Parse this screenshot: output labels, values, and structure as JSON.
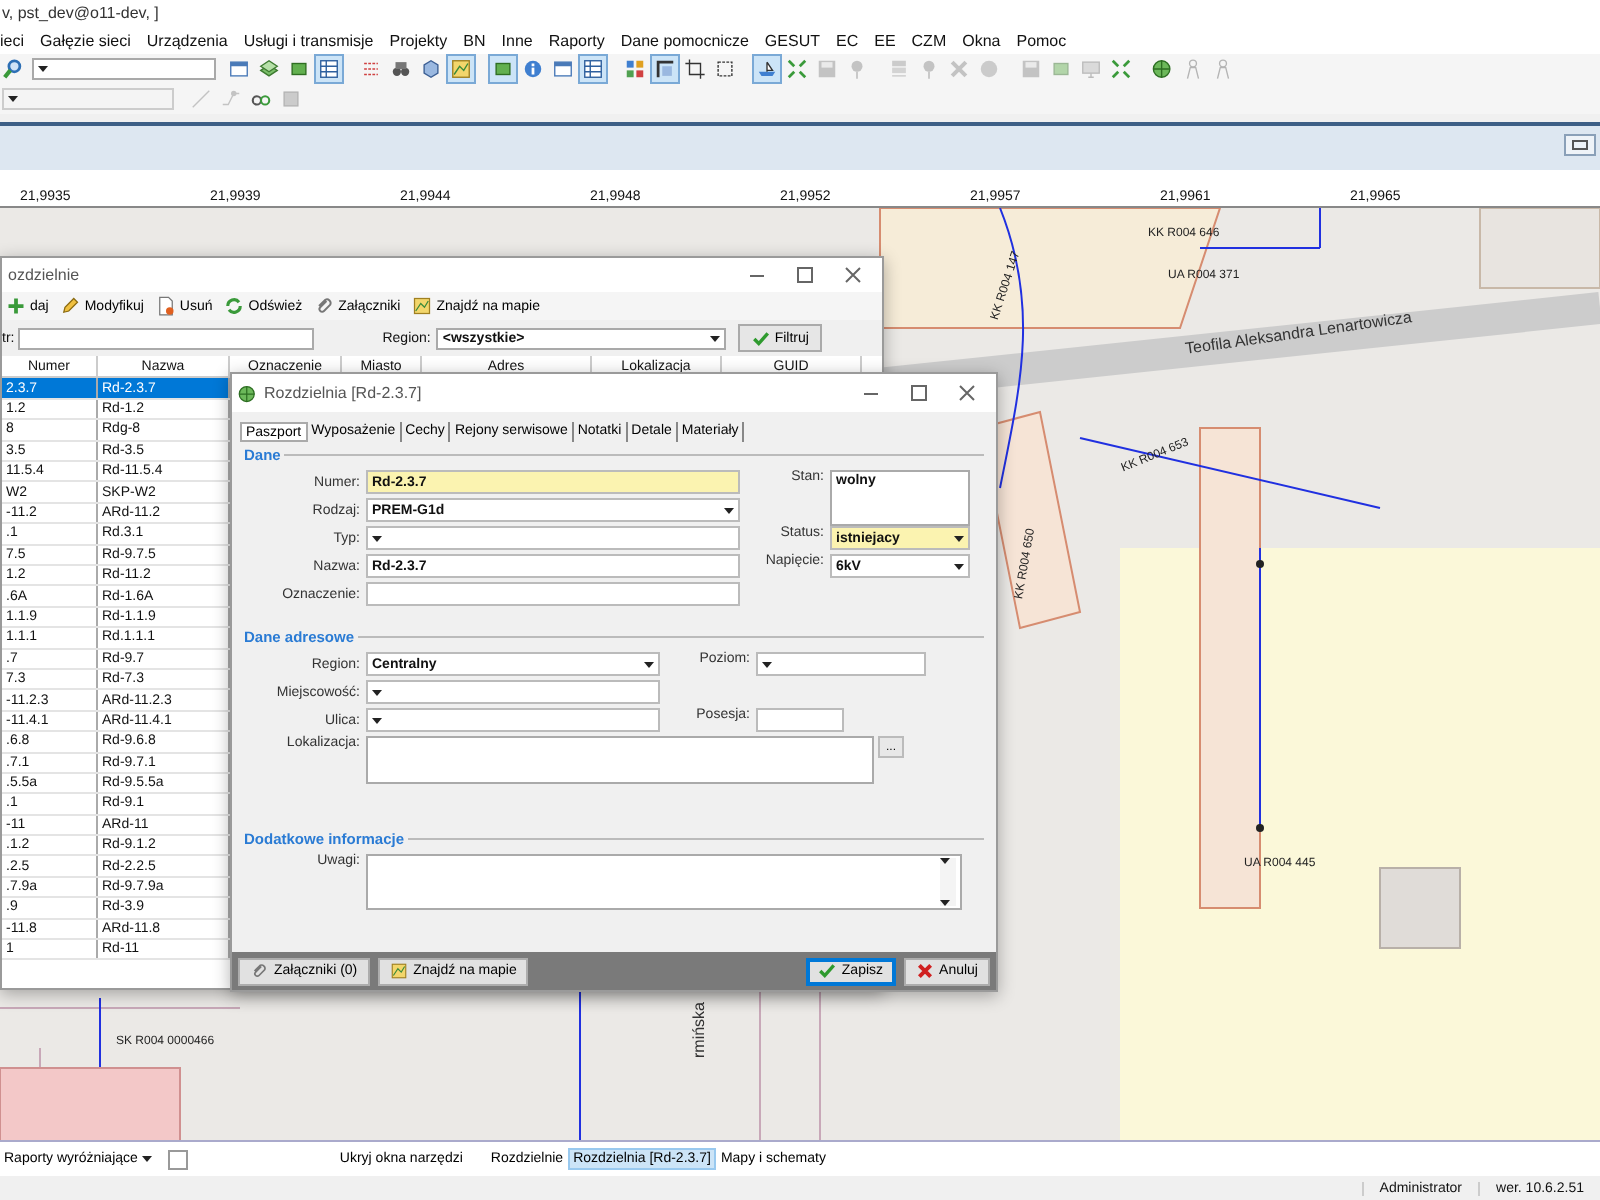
{
  "window": {
    "title": "v, pst_dev@o11-dev, ]"
  },
  "menu": [
    "ieci",
    "Gałęzie sieci",
    "Urządzenia",
    "Usługi i transmisje",
    "Projekty",
    "BN",
    "Inne",
    "Raporty",
    "Dane pomocnicze",
    "GESUT",
    "EC",
    "EE",
    "CZM",
    "Okna",
    "Pomoc"
  ],
  "toolbar_1": {
    "items": [
      {
        "kind": "window",
        "selected": false,
        "disabled": false
      },
      {
        "kind": "layers",
        "selected": false,
        "disabled": false
      },
      {
        "kind": "box",
        "selected": false,
        "disabled": false
      },
      {
        "kind": "table",
        "selected": true,
        "disabled": false
      },
      {
        "kind": "dots",
        "selected": false,
        "disabled": false
      },
      {
        "kind": "binoculars",
        "selected": false,
        "disabled": false
      },
      {
        "kind": "cube",
        "selected": false,
        "disabled": false
      },
      {
        "kind": "map",
        "selected": true,
        "disabled": false
      },
      {
        "kind": "box",
        "selected": true,
        "disabled": false
      },
      {
        "kind": "info",
        "selected": false,
        "disabled": false
      },
      {
        "kind": "window",
        "selected": false,
        "disabled": false
      },
      {
        "kind": "table",
        "selected": true,
        "disabled": false
      },
      {
        "kind": "grid",
        "selected": false,
        "disabled": false
      },
      {
        "kind": "frame",
        "selected": true,
        "disabled": false
      },
      {
        "kind": "crop",
        "selected": false,
        "disabled": false
      },
      {
        "kind": "expand",
        "selected": false,
        "disabled": false
      },
      {
        "kind": "boat",
        "selected": true,
        "disabled": false
      },
      {
        "kind": "arrows",
        "selected": false,
        "disabled": false
      },
      {
        "kind": "disk",
        "selected": false,
        "disabled": true
      },
      {
        "kind": "pin",
        "selected": false,
        "disabled": true
      },
      {
        "kind": "stack",
        "selected": false,
        "disabled": true
      },
      {
        "kind": "pin",
        "selected": false,
        "disabled": true
      },
      {
        "kind": "cross",
        "selected": false,
        "disabled": true
      },
      {
        "kind": "circle",
        "selected": false,
        "disabled": true
      },
      {
        "kind": "disk",
        "selected": false,
        "disabled": true
      },
      {
        "kind": "box",
        "selected": false,
        "disabled": true
      },
      {
        "kind": "monitor",
        "selected": false,
        "disabled": true
      },
      {
        "kind": "arrows",
        "selected": false,
        "disabled": false
      },
      {
        "kind": "globe",
        "selected": false,
        "disabled": false
      },
      {
        "kind": "person",
        "selected": false,
        "disabled": true
      },
      {
        "kind": "person",
        "selected": false,
        "disabled": true
      }
    ]
  },
  "toolbar_2": {
    "items": [
      {
        "kind": "line",
        "selected": false,
        "disabled": true
      },
      {
        "kind": "node",
        "selected": false,
        "disabled": true
      },
      {
        "kind": "link",
        "selected": false,
        "disabled": false
      },
      {
        "kind": "stop",
        "selected": false,
        "disabled": true
      }
    ]
  },
  "ruler": {
    "ticks": [
      "21,9935",
      "21,9939",
      "21,9944",
      "21,9948",
      "21,9952",
      "21,9957",
      "21,9961",
      "21,9965"
    ]
  },
  "map": {
    "labels": [
      {
        "text": "Teofila Aleksandra Lenartowicza",
        "kind": "street"
      },
      {
        "text": "KK R004 646",
        "kind": "asset"
      },
      {
        "text": "UA R004 371",
        "kind": "asset"
      },
      {
        "text": "KK R004 653",
        "kind": "asset"
      },
      {
        "text": "KK R004 147",
        "kind": "asset"
      },
      {
        "text": "KK R004 650",
        "kind": "asset"
      },
      {
        "text": "UA R004 445",
        "kind": "asset"
      },
      {
        "text": "SK R004 0000466",
        "kind": "asset"
      },
      {
        "text": "rmińska",
        "kind": "street"
      }
    ]
  },
  "list_window": {
    "title": "ozdzielnie",
    "toolbar": [
      {
        "label": "daj",
        "kind": "plus"
      },
      {
        "label": "Modyfikuj",
        "kind": "pencil"
      },
      {
        "label": "Usuń",
        "kind": "doc"
      },
      {
        "label": "Odśwież",
        "kind": "refresh"
      },
      {
        "label": "Załączniki",
        "kind": "clip"
      },
      {
        "label": "Znajdź na mapie",
        "kind": "map"
      }
    ],
    "filter": {
      "label": "tr:",
      "region_label": "Region:",
      "region_value": "<wszystkie>",
      "button": "Filtruj"
    },
    "columns": [
      "Numer",
      "Nazwa",
      "Oznaczenie",
      "Miasto",
      "Adres",
      "Lokalizacja",
      "GUID"
    ],
    "rows": [
      {
        "numer": "2.3.7",
        "nazwa": "Rd-2.3.7",
        "selected": true
      },
      {
        "numer": "1.2",
        "nazwa": "Rd-1.2",
        "selected": false
      },
      {
        "numer": "8",
        "nazwa": "Rdg-8",
        "selected": false
      },
      {
        "numer": "3.5",
        "nazwa": "Rd-3.5",
        "selected": false
      },
      {
        "numer": "11.5.4",
        "nazwa": "Rd-11.5.4",
        "selected": false
      },
      {
        "numer": "W2",
        "nazwa": "SKP-W2",
        "selected": false
      },
      {
        "numer": "-11.2",
        "nazwa": "ARd-11.2",
        "selected": false
      },
      {
        "numer": ".1",
        "nazwa": "Rd.3.1",
        "selected": false
      },
      {
        "numer": "7.5",
        "nazwa": "Rd-9.7.5",
        "selected": false
      },
      {
        "numer": "1.2",
        "nazwa": "Rd-11.2",
        "selected": false
      },
      {
        "numer": ".6A",
        "nazwa": "Rd-1.6A",
        "selected": false
      },
      {
        "numer": "1.1.9",
        "nazwa": "Rd-1.1.9",
        "selected": false
      },
      {
        "numer": "1.1.1",
        "nazwa": "Rd.1.1.1",
        "selected": false
      },
      {
        "numer": ".7",
        "nazwa": "Rd-9.7",
        "selected": false
      },
      {
        "numer": "7.3",
        "nazwa": "Rd-7.3",
        "selected": false
      },
      {
        "numer": "-11.2.3",
        "nazwa": "ARd-11.2.3",
        "selected": false
      },
      {
        "numer": "-11.4.1",
        "nazwa": "ARd-11.4.1",
        "selected": false
      },
      {
        "numer": ".6.8",
        "nazwa": "Rd-9.6.8",
        "selected": false
      },
      {
        "numer": ".7.1",
        "nazwa": "Rd-9.7.1",
        "selected": false
      },
      {
        "numer": ".5.5a",
        "nazwa": "Rd-9.5.5a",
        "selected": false
      },
      {
        "numer": ".1",
        "nazwa": "Rd-9.1",
        "selected": false
      },
      {
        "numer": "-11",
        "nazwa": "ARd-11",
        "selected": false
      },
      {
        "numer": ".1.2",
        "nazwa": "Rd-9.1.2",
        "selected": false
      },
      {
        "numer": ".2.5",
        "nazwa": "Rd-2.2.5",
        "selected": false
      },
      {
        "numer": ".7.9a",
        "nazwa": "Rd-9.7.9a",
        "selected": false
      },
      {
        "numer": ".9",
        "nazwa": "Rd-3.9",
        "selected": false
      },
      {
        "numer": "-11.8",
        "nazwa": "ARd-11.8",
        "selected": false
      },
      {
        "numer": "1",
        "nazwa": "Rd-11",
        "selected": false
      }
    ]
  },
  "dialog": {
    "title": "Rozdzielnia [Rd-2.3.7]",
    "tabs": [
      {
        "label": "Paszport",
        "selected": true
      },
      {
        "label": "Wyposażenie",
        "selected": false
      },
      {
        "label": "Cechy",
        "selected": false
      },
      {
        "label": "Rejony serwisowe",
        "selected": false
      },
      {
        "label": "Notatki",
        "selected": false
      },
      {
        "label": "Detale",
        "selected": false
      },
      {
        "label": "Materiały",
        "selected": false
      }
    ],
    "sections": [
      {
        "title": "Dane",
        "left": [
          {
            "label": "Numer:",
            "kind": "text",
            "value": "Rd-2.3.7",
            "required": true
          },
          {
            "label": "Rodzaj:",
            "kind": "combo",
            "value": "PREM-G1d",
            "required": false
          },
          {
            "label": "Typ:",
            "kind": "combo",
            "required": false
          },
          {
            "label": "Nazwa:",
            "kind": "text",
            "value": "Rd-2.3.7",
            "required": false
          },
          {
            "label": "Oznaczenie:",
            "kind": "text",
            "required": false
          }
        ],
        "right": [
          {
            "label": "Stan:",
            "kind": "memo",
            "value": "wolny",
            "required": false
          },
          {
            "label": "Status:",
            "kind": "combo",
            "value": "istniejacy",
            "required": true
          },
          {
            "label": "Napięcie:",
            "kind": "combo",
            "value": "6kV",
            "required": false
          }
        ]
      },
      {
        "title": "Dane adresowe",
        "left": [
          {
            "label": "Region:",
            "kind": "combo",
            "value": "Centralny",
            "required": false
          },
          {
            "label": "Miejscowość:",
            "kind": "combo",
            "required": false
          },
          {
            "label": "Ulica:",
            "kind": "combo",
            "required": false
          },
          {
            "label": "Lokalizacja:",
            "kind": "memo_button",
            "button": "...",
            "required": false
          }
        ],
        "right": [
          {
            "label": "Poziom:",
            "kind": "combo",
            "required": false
          },
          {
            "label": "Posesja:",
            "kind": "text",
            "required": false
          }
        ]
      },
      {
        "title": "Dodatkowe informacje",
        "left": [
          {
            "label": "Uwagi:",
            "kind": "memo_scroll",
            "required": false
          }
        ]
      }
    ],
    "buttons": [
      {
        "label": "Załączniki (0)",
        "kind": "clip",
        "default": false
      },
      {
        "label": "Znajdź na mapie",
        "kind": "map",
        "default": false
      },
      {
        "label": "Zapisz",
        "kind": "check",
        "default": true
      },
      {
        "label": "Anuluj",
        "kind": "x",
        "default": false
      }
    ]
  },
  "taskbar": {
    "reports": "Raporty wyróżniające",
    "checked": false,
    "hide_tools": "Ukryj okna narzędzi",
    "tabs": [
      {
        "label": "Rozdzielnie",
        "selected": false
      },
      {
        "label": "Rozdzielnia [Rd-2.3.7]",
        "selected": true
      },
      {
        "label": "Mapy i schematy",
        "selected": false
      }
    ]
  },
  "status_bar": {
    "user": "Administrator",
    "version": "wer. 10.6.2.51"
  }
}
